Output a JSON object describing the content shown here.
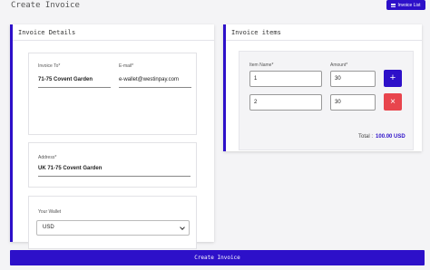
{
  "header": {
    "title": "Create Invoice",
    "invoice_list_label": "Invoice List"
  },
  "details": {
    "title": "Invoice Details",
    "invoice_to_label": "Invoice To*",
    "invoice_to_value": "71-75 Covent Garden",
    "email_label": "E-mail*",
    "email_value": "e-wallet@westinpay.com",
    "address_label": "Address*",
    "address_value": "UK 71-75 Covent Garden",
    "wallet_label": "Your Wallet",
    "wallet_value": "USD"
  },
  "items": {
    "title": "Invoice items",
    "item_name_label": "Item Name*",
    "amount_label": "Amount*",
    "rows": [
      {
        "name": "1",
        "amount": "30"
      },
      {
        "name": "2",
        "amount": "30"
      }
    ],
    "add_symbol": "+",
    "remove_symbol": "×",
    "total_label": "Total :",
    "total_value": "100.00 USD"
  },
  "footer": {
    "create_label": "Create Invoice"
  },
  "colors": {
    "accent": "#2d10c9",
    "danger": "#e8454d"
  }
}
